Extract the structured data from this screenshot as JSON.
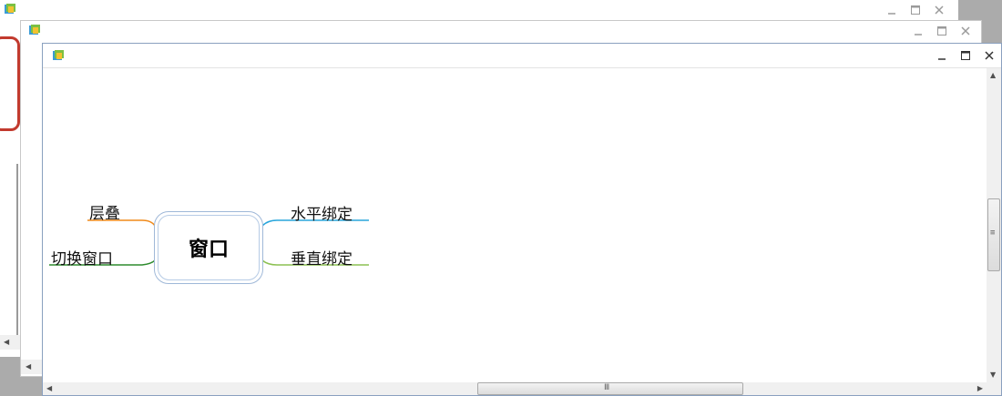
{
  "windows": {
    "outer": {
      "title": ""
    },
    "middle": {
      "title": ""
    },
    "front": {
      "title": ""
    }
  },
  "mindmap": {
    "central_topic": "窗口",
    "left_topics": [
      "层叠",
      "切换窗口"
    ],
    "right_topics": [
      "水平绑定",
      "垂直绑定"
    ],
    "branch_colors": {
      "层叠": "#f08a1a",
      "切换窗口": "#2e8b2e",
      "水平绑定": "#29a6dc",
      "垂直绑定": "#8cc152"
    }
  },
  "scrollbars": {
    "h_grip": "Ⅲ",
    "v_grip": "≡"
  },
  "icons": [
    "app-icon",
    "minimize-icon",
    "maximize-icon",
    "close-icon",
    "scroll-left-icon",
    "scroll-right-icon",
    "scroll-up-icon",
    "scroll-down-icon"
  ]
}
